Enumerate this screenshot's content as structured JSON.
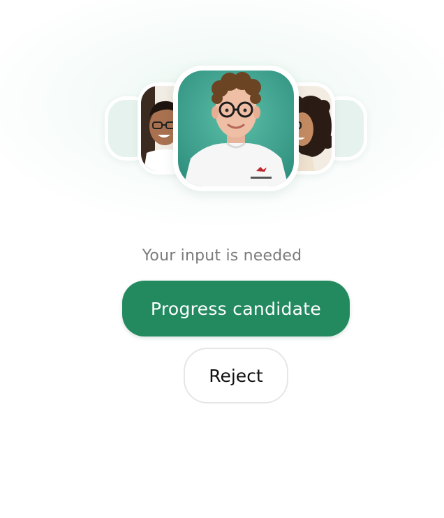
{
  "prompt": {
    "text": "Your input is needed"
  },
  "actions": {
    "progress_label": "Progress candidate",
    "reject_label": "Reject"
  },
  "candidates": [
    {
      "position": "far-left",
      "kind": "placeholder"
    },
    {
      "position": "left",
      "kind": "photo"
    },
    {
      "position": "center",
      "kind": "photo",
      "featured": true
    },
    {
      "position": "right",
      "kind": "photo"
    },
    {
      "position": "far-right",
      "kind": "placeholder"
    }
  ],
  "colors": {
    "primary": "#238a60",
    "placeholder": "#e6f2ee",
    "center_photo_bg": "#3aa892",
    "prompt_text": "#7b7b7b"
  }
}
